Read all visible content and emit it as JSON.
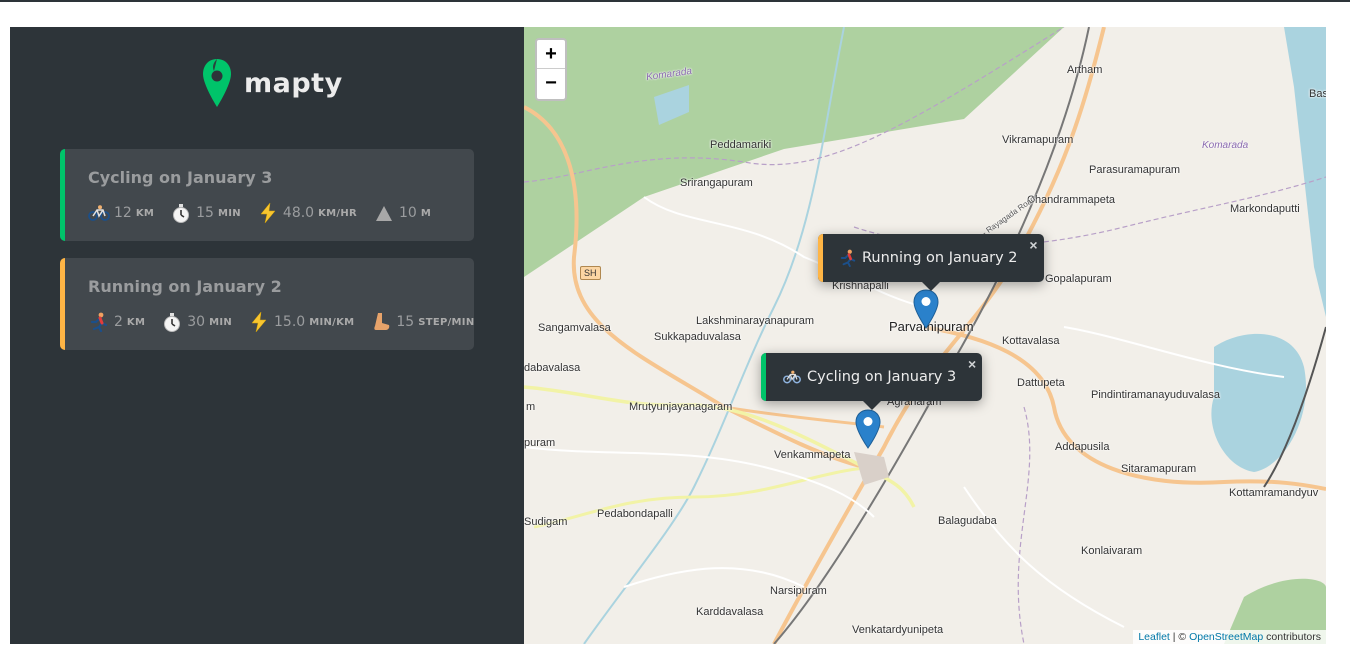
{
  "app": {
    "logo_text": "mapty",
    "logo_icon": "map-pin-icon",
    "brand_green": "#00c46a",
    "brand_yellow": "#ffb545"
  },
  "workouts": [
    {
      "type": "cycling",
      "title": "Cycling on January 3",
      "accent": "#00c46a",
      "details": [
        {
          "icon": "bicycle-icon",
          "value": "12",
          "unit": "KM"
        },
        {
          "icon": "stopwatch-icon",
          "value": "15",
          "unit": "MIN"
        },
        {
          "icon": "lightning-icon",
          "value": "48.0",
          "unit": "KM/HR"
        },
        {
          "icon": "mountain-icon",
          "value": "10",
          "unit": "M"
        }
      ]
    },
    {
      "type": "running",
      "title": "Running on January 2",
      "accent": "#ffb545",
      "details": [
        {
          "icon": "runner-icon",
          "value": "2",
          "unit": "KM"
        },
        {
          "icon": "stopwatch-icon",
          "value": "30",
          "unit": "MIN"
        },
        {
          "icon": "lightning-icon",
          "value": "15.0",
          "unit": "MIN/KM"
        },
        {
          "icon": "footprint-icon",
          "value": "15",
          "unit": "STEP/MIN"
        }
      ]
    }
  ],
  "map": {
    "zoom_in": "+",
    "zoom_out": "−",
    "popups": {
      "running": {
        "text": "Running on January 2",
        "icon": "runner-icon",
        "close": "×"
      },
      "cycling": {
        "text": "Cycling on January 3",
        "icon": "bicycle-icon",
        "close": "×"
      }
    },
    "places": {
      "komarada_w": "Komarada",
      "komarada_e": "Komarada",
      "artham": "Artham",
      "bas": "Bas",
      "peddamariki": "Peddamariki",
      "vikramapuram": "Vikramapuram",
      "parasuramapuram": "Parasuramapuram",
      "srirangapuram": "Srirangapuram",
      "chandrammapeta": "Chandrammapeta",
      "markondaputti": "Markondaputti",
      "sh": "SH",
      "krishnapalli": "Krishnapalli",
      "gopalapuram": "Gopalapuram",
      "sangamvalasa": "Sangamvalasa",
      "lakshminarayanapuram": "Lakshminarayanapuram",
      "parvathipuram": "Parvathipuram",
      "sukkapaduvalasa": "Sukkapaduvalasa",
      "kottavalasa": "Kottavalasa",
      "dabavalasa": "dabavalasa",
      "dattupeta": "Dattupeta",
      "pindintiramanayuduvalasa": "Pindintiramanayuduvalasa",
      "m_edge": "m",
      "mrutyunjayanagaram": "Mrutyunjayanagaram",
      "agraharam": "Agraharam",
      "addapusila": "Addapusila",
      "puram_edge": "puram",
      "venkammapeta": "Venkammapeta",
      "sitaramapuram": "Sitaramapuram",
      "kottamramandyuv": "Kottamramandyuv",
      "sudigam": "Sudigam",
      "pedabondapalli": "Pedabondapalli",
      "balagudaba": "Balagudaba",
      "konlaivaram": "Konlaivaram",
      "narsipuram": "Narsipuram",
      "karddavalasa": "Karddavalasa",
      "venkatardyunipeta": "Venkatardyunipeta",
      "road_label": "Parvathipuram - Rayagada Road"
    },
    "attribution": {
      "leaflet": "Leaflet",
      "sep": " | © ",
      "osm": "OpenStreetMap",
      "suffix": " contributors"
    }
  }
}
